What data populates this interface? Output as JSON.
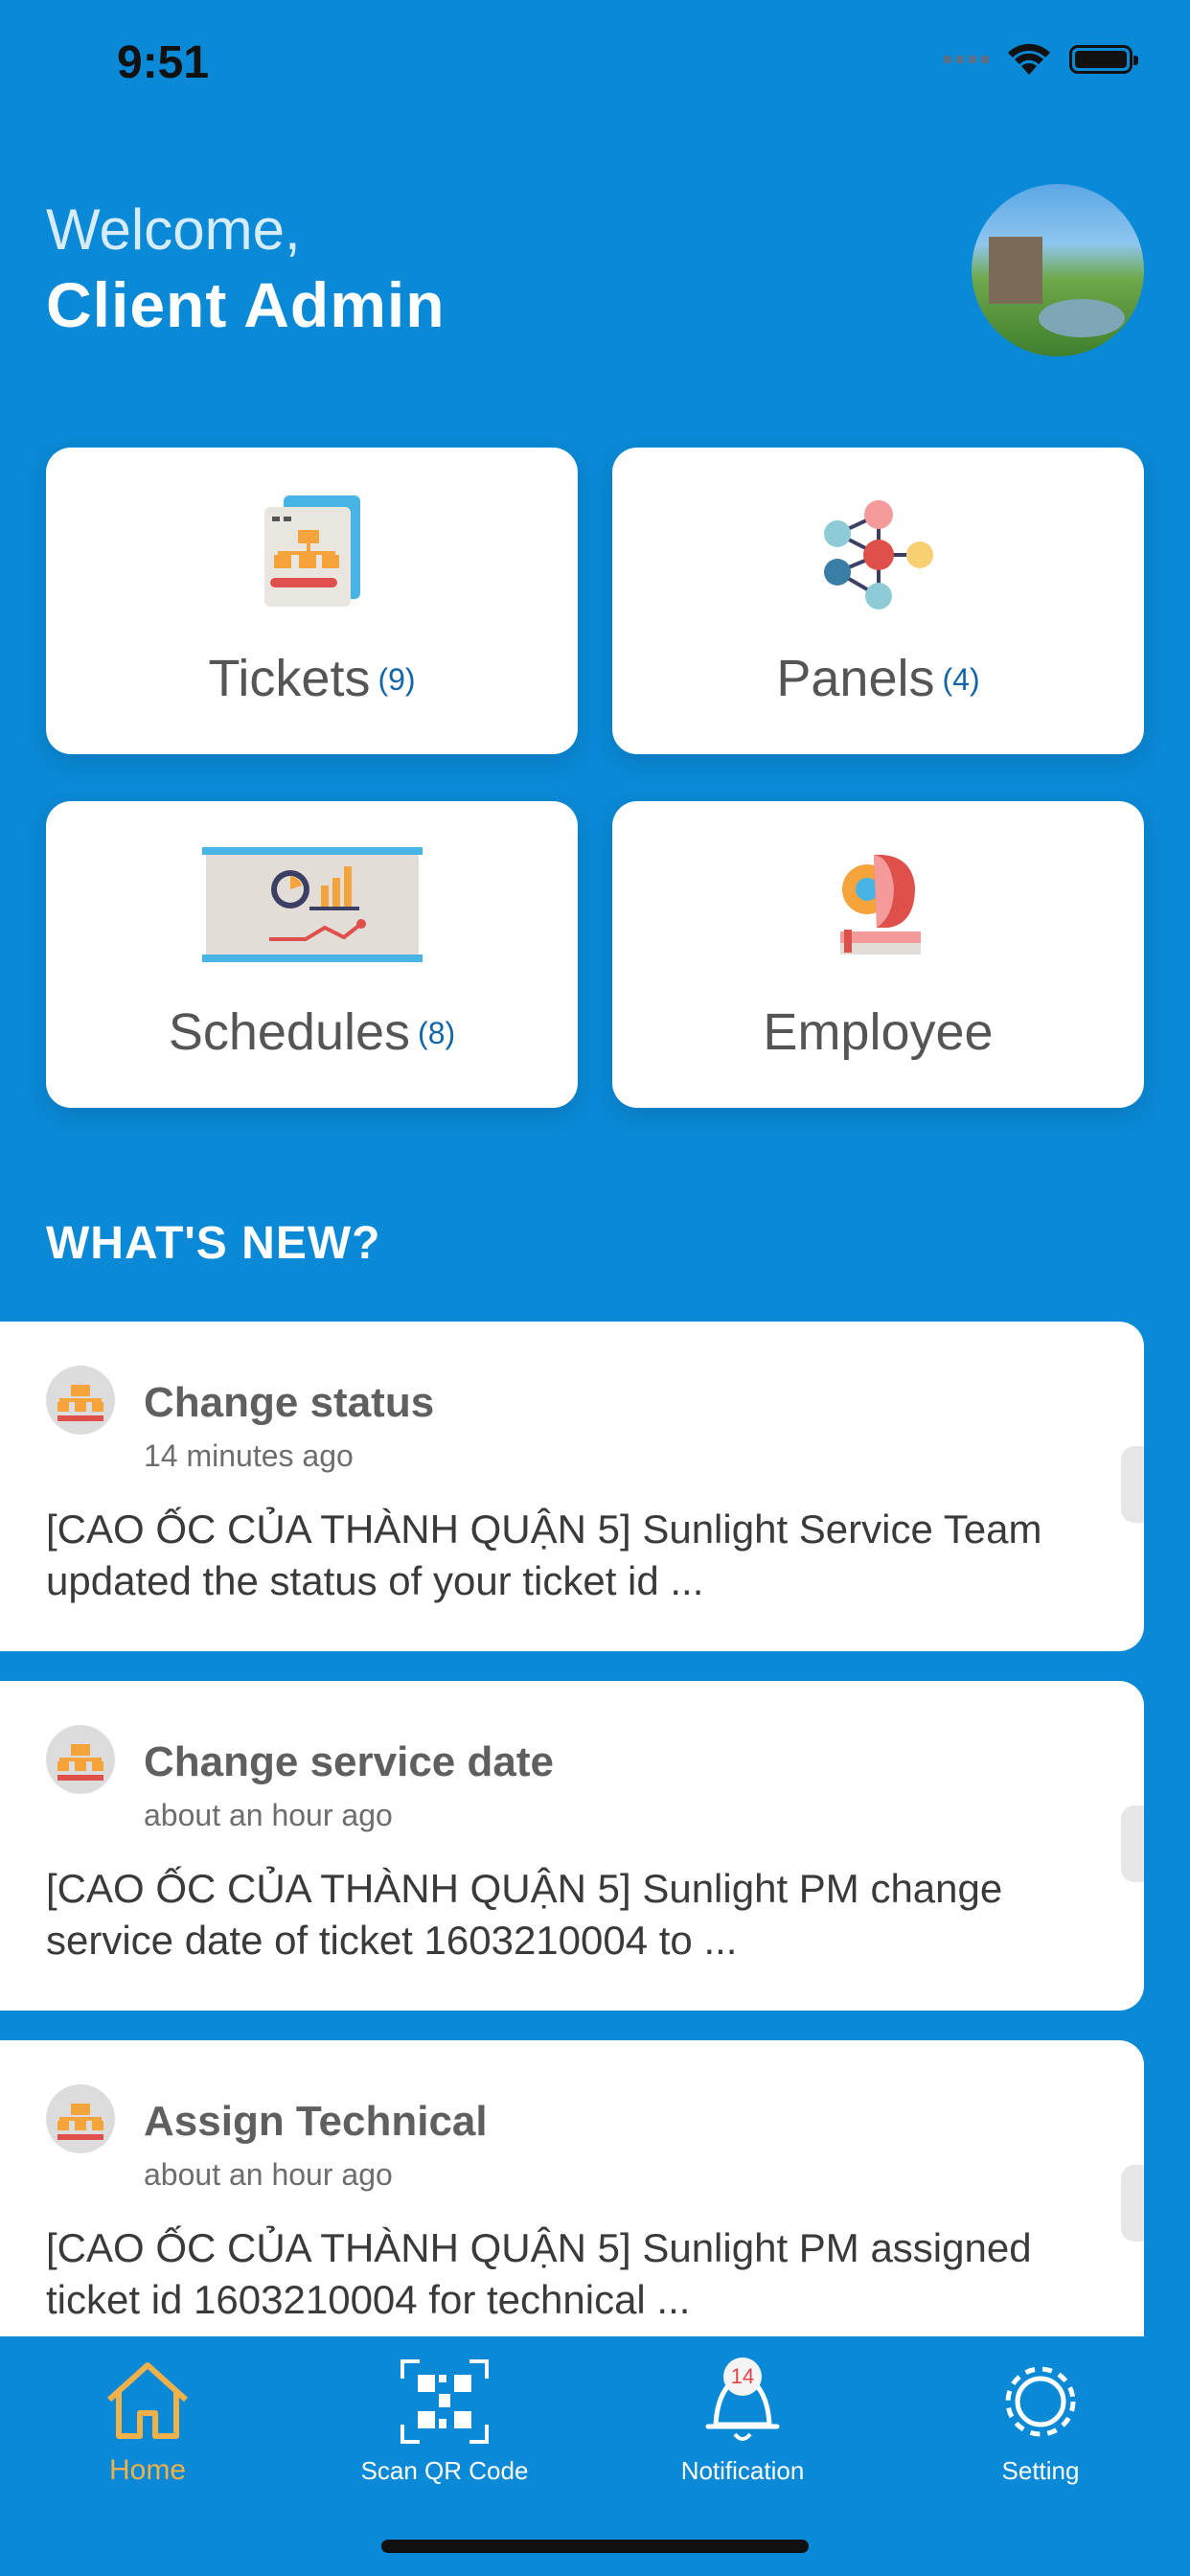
{
  "status_bar": {
    "time": "9:51"
  },
  "header": {
    "greeting": "Welcome,",
    "user_name": "Client Admin"
  },
  "tiles": [
    {
      "label": "Tickets",
      "count": "(9)",
      "icon": "tickets-icon"
    },
    {
      "label": "Panels",
      "count": "(4)",
      "icon": "panels-icon"
    },
    {
      "label": "Schedules",
      "count": "(8)",
      "icon": "schedules-icon"
    },
    {
      "label": "Employee",
      "count": "",
      "icon": "employee-icon"
    }
  ],
  "whats_new": {
    "title": "WHAT'S NEW?",
    "items": [
      {
        "title": "Change status",
        "time": "14 minutes ago",
        "body": "[CAO ỐC CỦA THÀNH QUẬN 5] Sunlight Service Team updated the status of your ticket id ..."
      },
      {
        "title": "Change service date",
        "time": "about an hour ago",
        "body": "[CAO ỐC CỦA THÀNH QUẬN 5] Sunlight PM change service date of ticket 1603210004 to ..."
      },
      {
        "title": "Assign Technical",
        "time": "about an hour ago",
        "body": "[CAO ỐC CỦA THÀNH QUẬN 5] Sunlight PM assigned ticket id 1603210004 for technical ..."
      }
    ]
  },
  "tabbar": {
    "active_color": "#f0b04a",
    "tabs": [
      {
        "label": "Home",
        "icon": "home-icon"
      },
      {
        "label": "Scan QR Code",
        "icon": "qr-code-icon"
      },
      {
        "label": "Notification",
        "icon": "bell-icon",
        "badge": "14"
      },
      {
        "label": "Setting",
        "icon": "gear-icon"
      }
    ]
  }
}
